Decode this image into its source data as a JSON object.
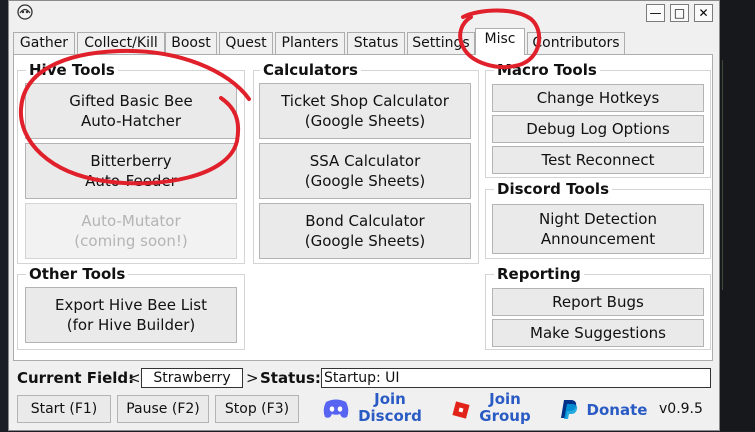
{
  "window": {
    "minimize_glyph": "—",
    "maximize_glyph": "□",
    "close_glyph": "✕"
  },
  "tabs": [
    {
      "label": "Gather"
    },
    {
      "label": "Collect/Kill"
    },
    {
      "label": "Boost"
    },
    {
      "label": "Quest"
    },
    {
      "label": "Planters"
    },
    {
      "label": "Status"
    },
    {
      "label": "Settings"
    },
    {
      "label": "Misc",
      "active": true
    },
    {
      "label": "Contributors"
    }
  ],
  "hive_tools": {
    "title": "Hive Tools",
    "gifted_hatcher": {
      "line1": "Gifted Basic Bee",
      "line2": "Auto-Hatcher"
    },
    "bitterberry_feeder": {
      "line1": "Bitterberry",
      "line2": "Auto-Feeder"
    },
    "auto_mutator": {
      "line1": "Auto-Mutator",
      "line2": "(coming soon!)"
    }
  },
  "calculators": {
    "title": "Calculators",
    "ticket_shop": {
      "line1": "Ticket Shop Calculator",
      "line2": "(Google Sheets)"
    },
    "ssa": {
      "line1": "SSA Calculator",
      "line2": "(Google Sheets)"
    },
    "bond": {
      "line1": "Bond Calculator",
      "line2": "(Google Sheets)"
    }
  },
  "other_tools": {
    "title": "Other Tools",
    "export_hive": {
      "line1": "Export Hive Bee List",
      "line2": "(for Hive Builder)"
    }
  },
  "macro_tools": {
    "title": "Macro Tools",
    "change_hotkeys": "Change Hotkeys",
    "debug_log": "Debug Log Options",
    "test_reconnect": "Test Reconnect"
  },
  "discord_tools": {
    "title": "Discord Tools",
    "night_detection": {
      "line1": "Night Detection",
      "line2": "Announcement"
    }
  },
  "reporting": {
    "title": "Reporting",
    "report_bugs": "Report Bugs",
    "make_suggestions": "Make Suggestions"
  },
  "status_bar": {
    "current_field_label": "Current Field:",
    "prev_arrow": "<",
    "next_arrow": ">",
    "current_field": "Strawberry",
    "status_label": "Status:",
    "status_value": "Startup: UI"
  },
  "bottom_bar": {
    "start": "Start (F1)",
    "pause": "Pause (F2)",
    "stop": "Stop (F3)",
    "join_discord": {
      "line1": "Join",
      "line2": "Discord"
    },
    "join_group": {
      "line1": "Join",
      "line2": "Group"
    },
    "donate": "Donate",
    "version": "v0.9.5"
  },
  "colors": {
    "annotation": "#e0202a",
    "discord": "#5865f2",
    "roblox": "#e2231a",
    "paypal_dark": "#003087",
    "paypal_light": "#009cde",
    "link_text": "#2a5bc4"
  }
}
